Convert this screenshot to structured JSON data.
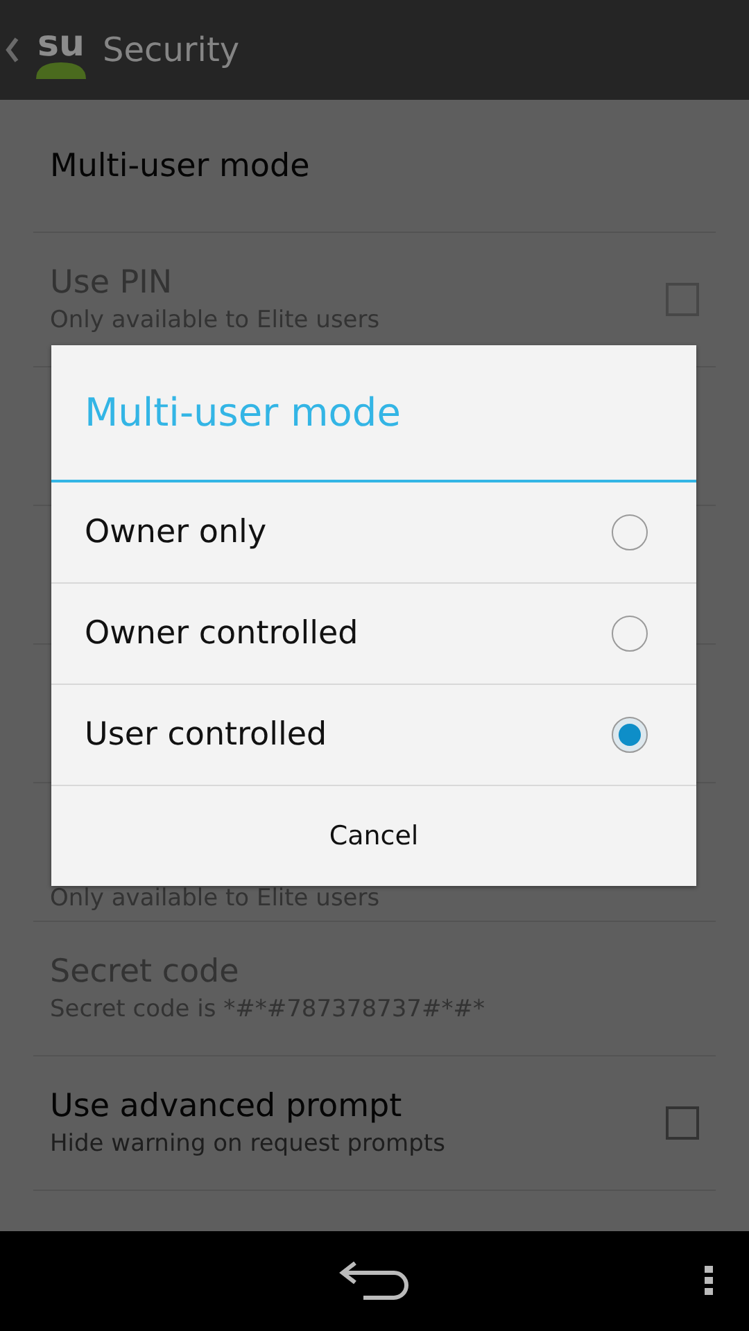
{
  "action_bar": {
    "logo_text": "su",
    "title": "Security"
  },
  "settings_top": [
    {
      "kind": "plain",
      "title": "Multi-user mode",
      "disabled": false
    },
    {
      "kind": "checkbox",
      "title": "Use PIN",
      "subtitle": "Only available to Elite users",
      "disabled": true,
      "checked": false
    }
  ],
  "settings_bottom": [
    {
      "kind": "plain",
      "subtitle": "Only available to Elite users",
      "disabled": true
    },
    {
      "kind": "plain",
      "title": "Secret code",
      "subtitle": "Secret code is *#*#787378737#*#*",
      "disabled": true
    },
    {
      "kind": "checkbox",
      "title": "Use advanced prompt",
      "subtitle": "Hide warning on request prompts",
      "disabled": false,
      "checked": false
    }
  ],
  "dialog": {
    "title": "Multi-user mode",
    "options": [
      {
        "label": "Owner only",
        "selected": false
      },
      {
        "label": "Owner controlled",
        "selected": false
      },
      {
        "label": "User controlled",
        "selected": true
      }
    ],
    "button": "Cancel"
  }
}
